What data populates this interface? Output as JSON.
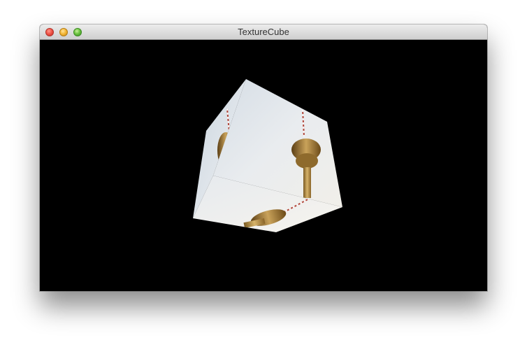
{
  "window": {
    "title": "TextureCube"
  },
  "titlebar": {
    "buttons": [
      {
        "name": "close-button",
        "color": "#f0564a"
      },
      {
        "name": "minimize-button",
        "color": "#f5b93a"
      },
      {
        "name": "zoom-button",
        "color": "#6cc442"
      }
    ]
  },
  "scene": {
    "background_color": "#000000",
    "object": "textured-cube",
    "texture_subject": "tv-tower"
  }
}
